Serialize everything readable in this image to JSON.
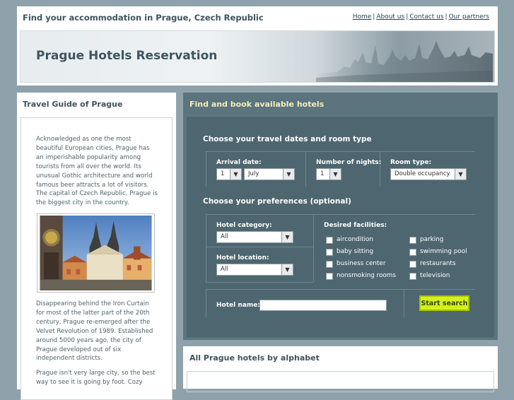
{
  "header": {
    "tagline": "Find your accommodation in Prague, Czech Republic",
    "nav": [
      {
        "label": "Home"
      },
      {
        "label": "About us"
      },
      {
        "label": "Contact us"
      },
      {
        "label": "Our partners"
      }
    ]
  },
  "banner": {
    "title": "Prague Hotels Reservation"
  },
  "guide": {
    "title": "Travel Guide of Prague",
    "paragraphs": [
      "Acknowledged as one the most beautiful European cities, Prague has an imperishable popularity among tourists from all over the world. Its unusual Gothic architecture and world famous beer attracts a lot of visitors. The capital of Czech Republic, Prague is the biggest city in the country.",
      "Disappearing behind the Iron Curtain for most of the latter part of the 20th century, Prague re-emerged after the Velvet Revolution of 1989. Established around 5000 years ago, the city of Prague developed out of six independent districts.",
      "Prague isn't very large city, so the best way to see it is going by foot. Cozy"
    ]
  },
  "search": {
    "title": "Find and book available hotels",
    "dates_section": "Choose your travel dates and room type",
    "arrival_label": "Arrival date:",
    "arrival_day": "1",
    "arrival_month": "July",
    "nights_label": "Number of nights:",
    "nights_value": "1",
    "room_label": "Room type:",
    "room_value": "Double occupancy",
    "prefs_section": "Choose your preferences (optional)",
    "category_label": "Hotel category:",
    "category_value": "All",
    "location_label": "Hotel location:",
    "location_value": "All",
    "facilities_label": "Desired facilities:",
    "facilities": [
      {
        "label": "aircondition"
      },
      {
        "label": "parking"
      },
      {
        "label": "baby sitting"
      },
      {
        "label": "swimming pool"
      },
      {
        "label": "business center"
      },
      {
        "label": "restaurants"
      },
      {
        "label": "nonsmoking rooms"
      },
      {
        "label": "television"
      }
    ],
    "hotel_name_label": "Hotel name:",
    "hotel_name_value": "",
    "submit_label": "Start search"
  },
  "alphabet": {
    "title": "All Prague hotels by alphabet"
  },
  "colors": {
    "page_bg": "#8fa2ab",
    "panel": "#5b747e",
    "panel_title": "#f4efb6",
    "button": "#d7f01d"
  }
}
